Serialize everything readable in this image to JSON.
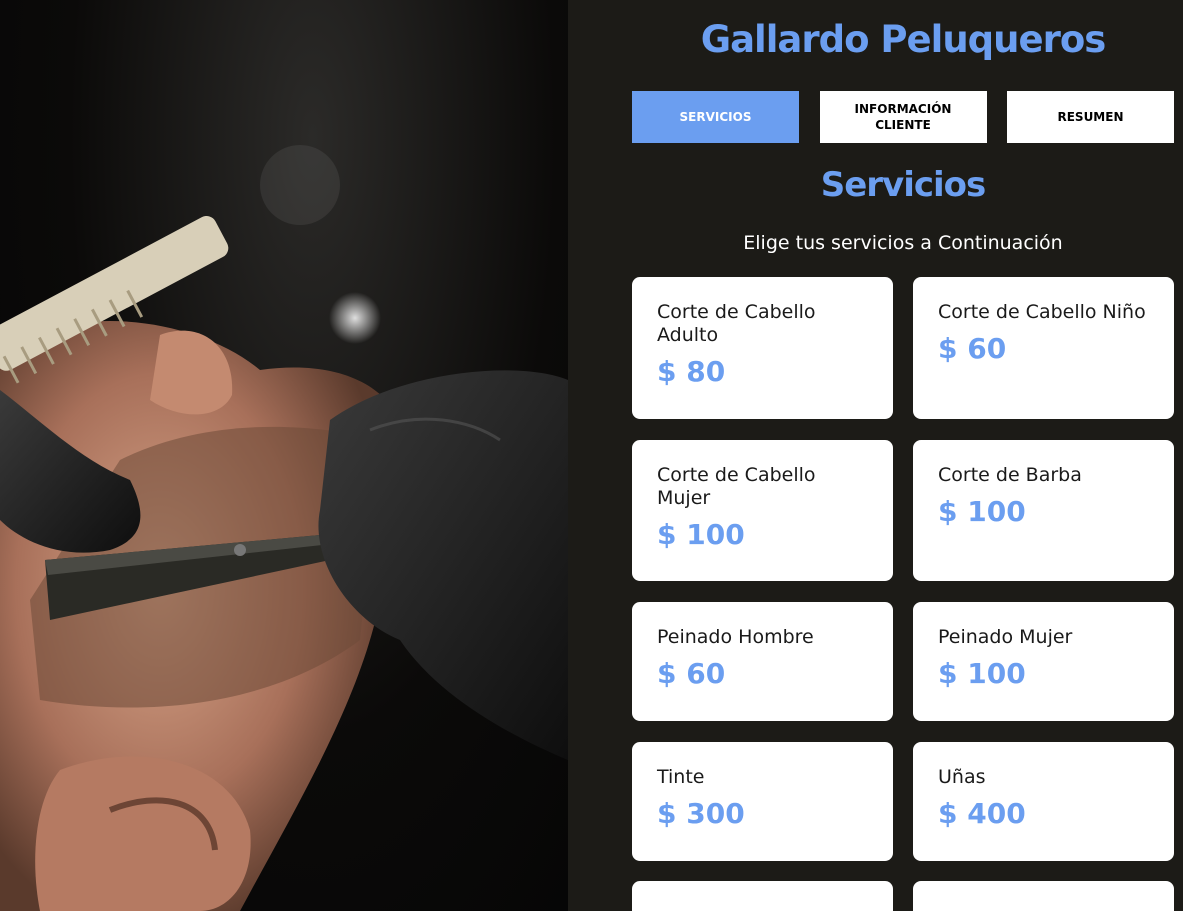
{
  "brand": "Gallardo Peluqueros",
  "tabs": [
    {
      "label": "Servicios",
      "active": true
    },
    {
      "label": "Información Cliente",
      "active": false
    },
    {
      "label": "Resumen",
      "active": false
    }
  ],
  "section": {
    "title": "Servicios",
    "subtitle": "Elige tus servicios a Continuación"
  },
  "services": [
    {
      "name": "Corte de Cabello Adulto",
      "price": "$ 80"
    },
    {
      "name": "Corte de Cabello Niño",
      "price": "$ 60"
    },
    {
      "name": "Corte de Cabello Mujer",
      "price": "$ 100"
    },
    {
      "name": "Corte de Barba",
      "price": "$ 100"
    },
    {
      "name": "Peinado Hombre",
      "price": "$ 60"
    },
    {
      "name": "Peinado Mujer",
      "price": "$ 100"
    },
    {
      "name": "Tinte",
      "price": "$ 300"
    },
    {
      "name": "Uñas",
      "price": "$ 400"
    }
  ],
  "colors": {
    "accent": "#6b9ef0",
    "background": "#1c1b17",
    "card": "#ffffff"
  }
}
